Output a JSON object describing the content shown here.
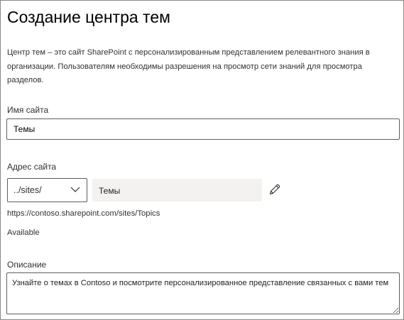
{
  "dialog": {
    "title": "Создание центра тем",
    "description": "Центр тем – это сайт SharePoint с персонализированным представлением релевантного знания в организации. Пользователям необходимы разрешения на просмотр сети знаний для просмотра разделов."
  },
  "site_name": {
    "label": "Имя сайта",
    "value": "Темы"
  },
  "site_address": {
    "label": "Адрес сайта",
    "prefix_selected": "../sites/",
    "url_value": "Темы",
    "full_url": "https://contoso.sharepoint.com/sites/Topics",
    "availability": "Available",
    "icons": {
      "dropdown": "chevron-down-icon",
      "edit": "pencil-icon"
    }
  },
  "description_field": {
    "label": "Описание",
    "value": "Узнайте о темах в Contoso и посмотрите персонализированное представление связанных с вами тем"
  },
  "colors": {
    "border": "#605e5c",
    "readonly_background": "#f3f2f1",
    "text": "#323130"
  }
}
